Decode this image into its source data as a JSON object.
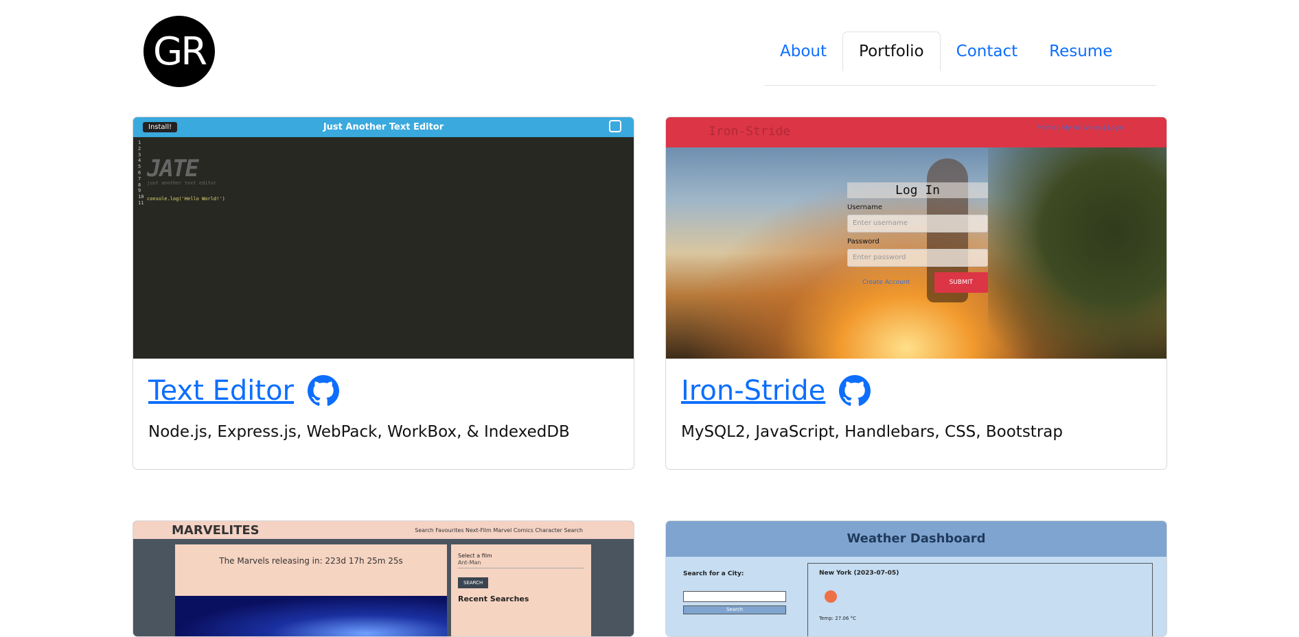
{
  "logo": {
    "text": "GR"
  },
  "nav": [
    {
      "label": "About",
      "active": false
    },
    {
      "label": "Portfolio",
      "active": true
    },
    {
      "label": "Contact",
      "active": false
    },
    {
      "label": "Resume",
      "active": false
    }
  ],
  "projects": [
    {
      "title": "Text Editor",
      "tech": "Node.js, Express.js, WebPack, WorkBox, & IndexedDB",
      "screenshot": {
        "install_label": "Install!",
        "app_title": "Just Another Text Editor",
        "line_numbers": "1\n2\n3\n4\n5\n6\n7\n8\n9\n10\n11",
        "ascii_logo": "JATE",
        "subtitle": "just another text editor",
        "code": "console.log('Hello World!')"
      }
    },
    {
      "title": "Iron-Stride",
      "tech": "MySQL2, JavaScript, Handlebars, CSS, Bootstrap",
      "screenshot": {
        "brand": "Iron-Stride",
        "nav_links": "Profile | My Activities | Login",
        "login_title": "Log In",
        "username_label": "Username",
        "username_placeholder": "Enter username",
        "password_label": "Password",
        "password_placeholder": "Enter password",
        "create_account": "Create Account",
        "submit": "SUBMIT"
      }
    },
    {
      "title": "",
      "tech": "",
      "screenshot": {
        "brand": "MARVELITES",
        "nav_links": "Search     Favourites     Next-Film     Marvel Comics Character Search",
        "countdown": "The Marvels releasing in: 223d 17h 25m 25s",
        "select_label": "Select a film",
        "select_value": "Ant-Man",
        "search_button": "SEARCH",
        "recent_searches": "Recent Searches"
      }
    },
    {
      "title": "",
      "tech": "",
      "screenshot": {
        "title": "Weather Dashboard",
        "search_label": "Search for a City:",
        "search_button": "Search",
        "city": "New York (2023-07-05)",
        "temp": "Temp: 27.06 °C"
      }
    }
  ]
}
